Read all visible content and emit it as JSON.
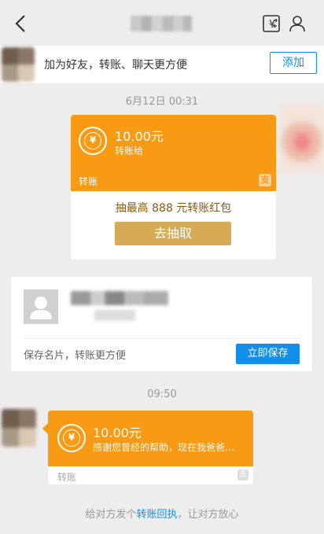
{
  "header": {
    "back_icon": "back-arrow-icon",
    "transfer_icon": "yuan-transfer-icon",
    "profile_icon": "person-icon"
  },
  "add_friend": {
    "text": "加为好友，转账、聊天更方便",
    "button_label": "添加"
  },
  "messages": [
    {
      "time": "6月12日 00:31",
      "amount": "10.00元",
      "note": "转账给",
      "tag": "转账",
      "promo": "抽最高 888 元转账红包",
      "action_label": "去抽取"
    },
    {
      "time": "09:50",
      "amount": "10.00元",
      "note": "感谢您曾经的帮助，现在我爸爸…",
      "tag": "转账"
    }
  ],
  "contact_card": {
    "hint": "保存名片，转账更方便",
    "save_label": "立即保存"
  },
  "receipt": {
    "prefix": "给对方发个",
    "link": "转账回执",
    "suffix": "，让对方放心"
  },
  "colors": {
    "accent_blue": "#108ee9",
    "transfer_orange": "#f99a15",
    "gold_button": "#d7aa55"
  }
}
